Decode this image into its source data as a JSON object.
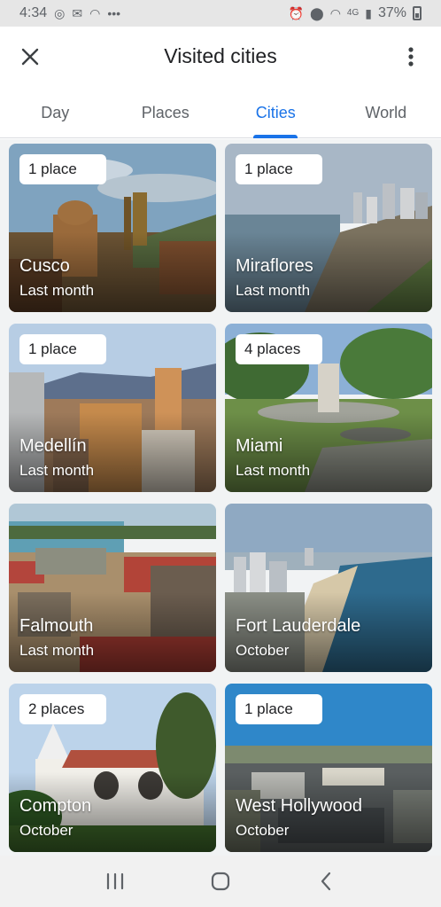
{
  "status_bar": {
    "time": "4:34",
    "battery": "37%",
    "signal_label": "4G"
  },
  "app_bar": {
    "title": "Visited cities",
    "close_icon": "close-icon",
    "more_icon": "more-vert-icon"
  },
  "tabs": [
    {
      "label": "Day",
      "active": false
    },
    {
      "label": "Places",
      "active": false
    },
    {
      "label": "Cities",
      "active": true
    },
    {
      "label": "World",
      "active": false
    }
  ],
  "accent_color": "#1a73e8",
  "cities": [
    {
      "name": "Cusco",
      "places": "1 place",
      "when": "Last month"
    },
    {
      "name": "Miraflores",
      "places": "1 place",
      "when": "Last month"
    },
    {
      "name": "Medellín",
      "places": "1 place",
      "when": "Last month"
    },
    {
      "name": "Miami",
      "places": "4 places",
      "when": "Last month"
    },
    {
      "name": "Falmouth",
      "places": "",
      "when": "Last month"
    },
    {
      "name": "Fort Lauderdale",
      "places": "",
      "when": "October"
    },
    {
      "name": "Compton",
      "places": "2 places",
      "when": "October"
    },
    {
      "name": "West Hollywood",
      "places": "1 place",
      "when": "October"
    }
  ],
  "nav_bar": {
    "recents_icon": "recents-icon",
    "home_icon": "home-icon",
    "back_icon": "back-icon"
  }
}
